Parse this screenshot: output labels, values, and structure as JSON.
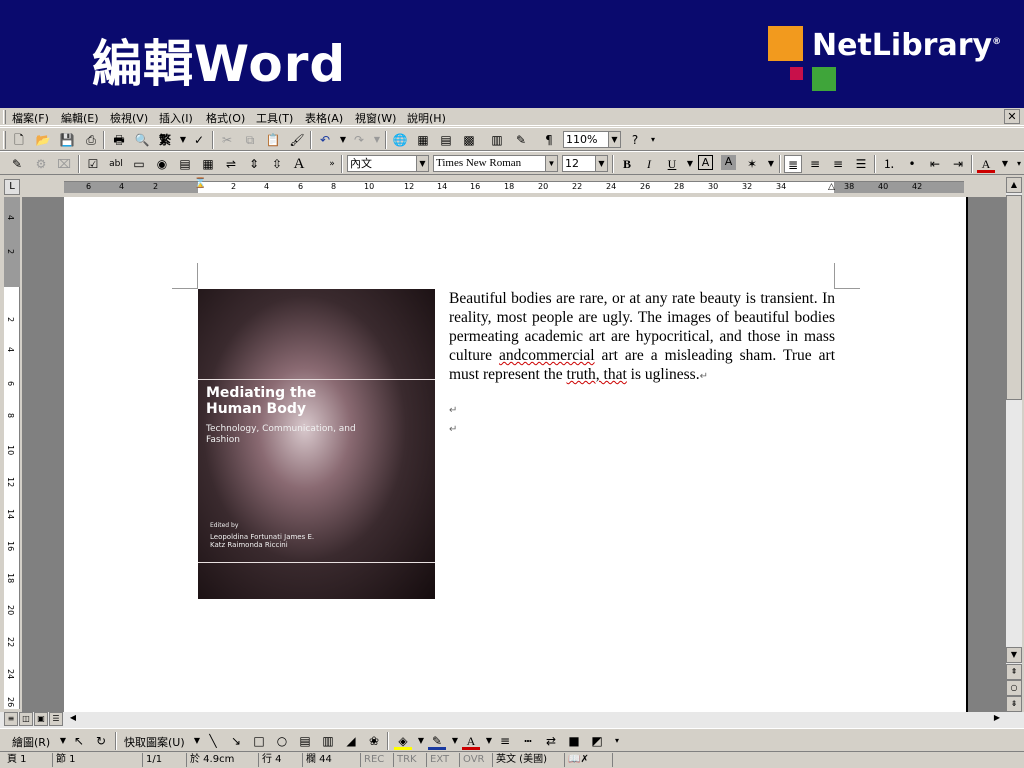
{
  "banner": {
    "title": "編輯Word",
    "logo_text": "NetLibrary",
    "logo_mark": "®"
  },
  "menu": {
    "items": [
      "檔案(F)",
      "編輯(E)",
      "檢視(V)",
      "插入(I)",
      "格式(O)",
      "工具(T)",
      "表格(A)",
      "視窗(W)",
      "說明(H)"
    ],
    "close": "✕"
  },
  "toolbar1": {
    "zoom": "110%",
    "font_cn_btn": "繁"
  },
  "toolbar2": {
    "style": "內文",
    "font": "Times New Roman",
    "size": "12"
  },
  "document": {
    "paragraph_parts": [
      "Beautiful bodies are rare, or at any rate beauty is transient. In reality, most people are ugly. The images of beautiful bodies permeating academic art are hypocritical, and those in mass culture ",
      "andcommercial",
      " art are a misleading sham. True art must represent the ",
      "truth, that",
      " is ugliness."
    ],
    "para_mark": "↵",
    "book": {
      "title": "Mediating the Human Body",
      "subtitle": "Technology, Communication, and Fashion",
      "edited_by": "Edited by",
      "editors": "Leopoldina Fortunati James E. Katz Raimonda Riccini"
    }
  },
  "ruler": {
    "h_numbers": [
      "6",
      "4",
      "2",
      "2",
      "4",
      "6",
      "8",
      "10",
      "12",
      "14",
      "16",
      "18",
      "20",
      "22",
      "24",
      "26",
      "28",
      "30",
      "32",
      "34",
      "38",
      "40",
      "42"
    ],
    "v_numbers": [
      "4",
      "2",
      "2",
      "4",
      "6",
      "8",
      "10",
      "12",
      "14",
      "16",
      "18",
      "20",
      "22",
      "24",
      "26"
    ]
  },
  "drawbar": {
    "draw_label": "繪圖(R)",
    "autoshapes_label": "快取圖案(U)"
  },
  "status": {
    "page": "頁 1",
    "section": "節 1",
    "pages": "1/1",
    "at": "於 4.9cm",
    "line": "行 4",
    "col": "欄 44",
    "rec": "REC",
    "trk": "TRK",
    "ext": "EXT",
    "ovr": "OVR",
    "lang": "英文 (美國)"
  },
  "colors": {
    "banner": "#0a0a6e",
    "logo_orange": "#f29a1e",
    "logo_red": "#c8104a",
    "logo_green": "#3fa53a"
  }
}
